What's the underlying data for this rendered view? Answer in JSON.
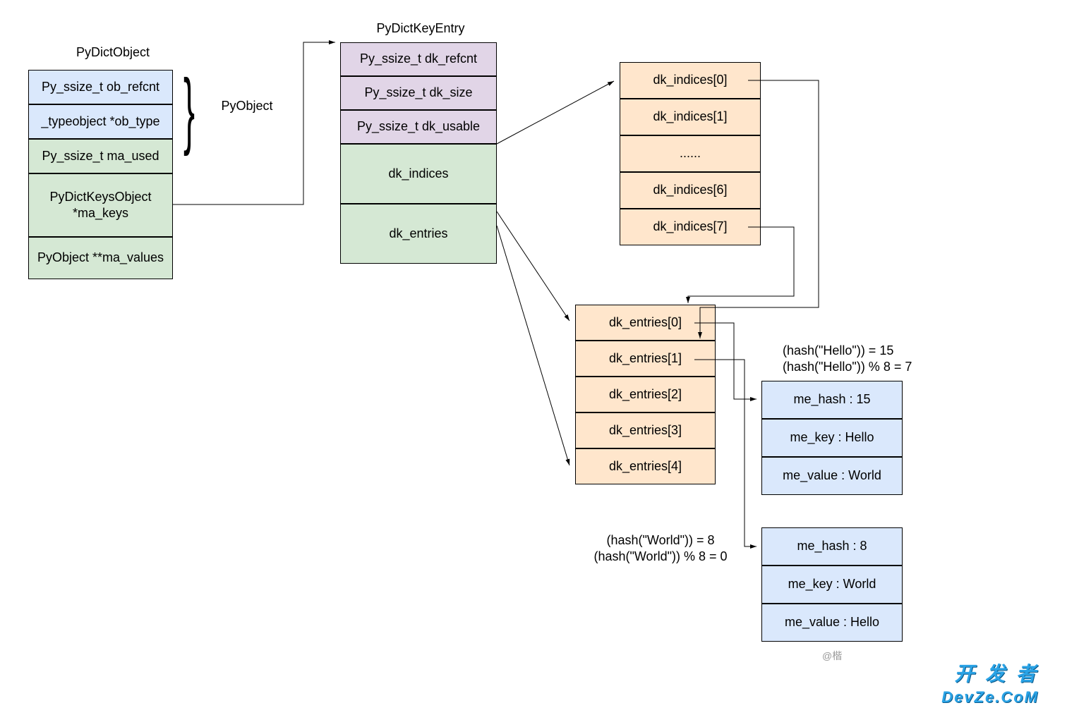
{
  "titles": {
    "pyDictObject": "PyDictObject",
    "pyDictKeyEntry": "PyDictKeyEntry",
    "pyObject": "PyObject"
  },
  "pyDictObject": {
    "f0": "Py_ssize_t ob_refcnt",
    "f1": "_typeobject *ob_type",
    "f2": "Py_ssize_t ma_used",
    "f3": "PyDictKeysObject *ma_keys",
    "f4": "PyObject **ma_values"
  },
  "pyDictKeyEntry": {
    "f0": "Py_ssize_t dk_refcnt",
    "f1": "Py_ssize_t dk_size",
    "f2": "Py_ssize_t dk_usable",
    "f3": "dk_indices",
    "f4": "dk_entries"
  },
  "dkIndices": {
    "i0": "dk_indices[0]",
    "i1": "dk_indices[1]",
    "i2": "......",
    "i6": "dk_indices[6]",
    "i7": "dk_indices[7]"
  },
  "dkEntries": {
    "e0": "dk_entries[0]",
    "e1": "dk_entries[1]",
    "e2": "dk_entries[2]",
    "e3": "dk_entries[3]",
    "e4": "dk_entries[4]"
  },
  "entry0": {
    "hash": "me_hash : 15",
    "key": "me_key : Hello",
    "value": "me_value : World"
  },
  "entry1": {
    "hash": "me_hash : 8",
    "key": "me_key : World",
    "value": "me_value : Hello"
  },
  "hashHello": {
    "l1": "(hash(\"Hello\")) = 15",
    "l2": "(hash(\"Hello\")) % 8 = 7"
  },
  "hashWorld": {
    "l1": "(hash(\"World\")) = 8",
    "l2": "(hash(\"World\")) % 8 = 0"
  },
  "watermark": "@楷",
  "logo": {
    "line1": "开 发 者",
    "line2": "DevZe.CoM"
  }
}
